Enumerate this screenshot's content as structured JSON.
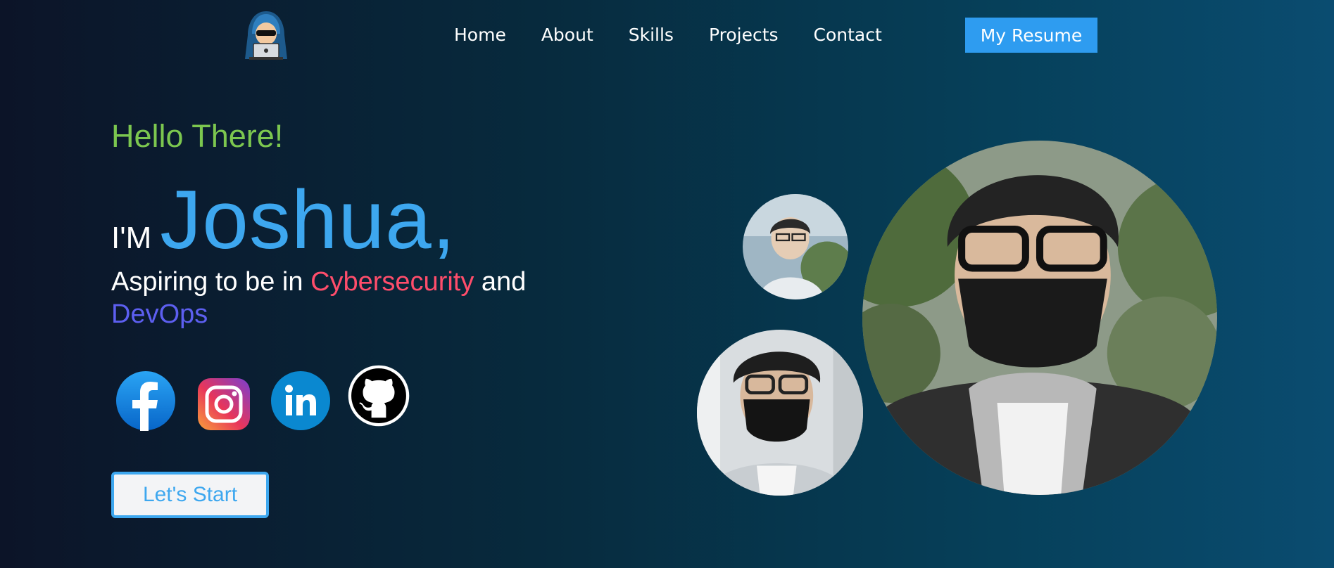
{
  "nav": {
    "logo_icon": "hacker-with-laptop-icon",
    "links": [
      "Home",
      "About",
      "Skills",
      "Projects",
      "Contact"
    ],
    "resume_label": "My Resume"
  },
  "hero": {
    "greeting": "Hello There!",
    "im": "I'M",
    "name": "Joshua,",
    "aspire_prefix": "Aspiring to be in ",
    "cyber": "Cybersecurity",
    "aspire_mid": " and",
    "devops": "DevOps",
    "cta_label": "Let's Start"
  },
  "social": [
    "facebook-icon",
    "instagram-icon",
    "linkedin-icon",
    "github-icon"
  ],
  "colors": {
    "greeting": "#7cc74f",
    "accent_blue": "#3da7ef",
    "cyber": "#ff4d6b",
    "devops": "#5d5ff0"
  }
}
